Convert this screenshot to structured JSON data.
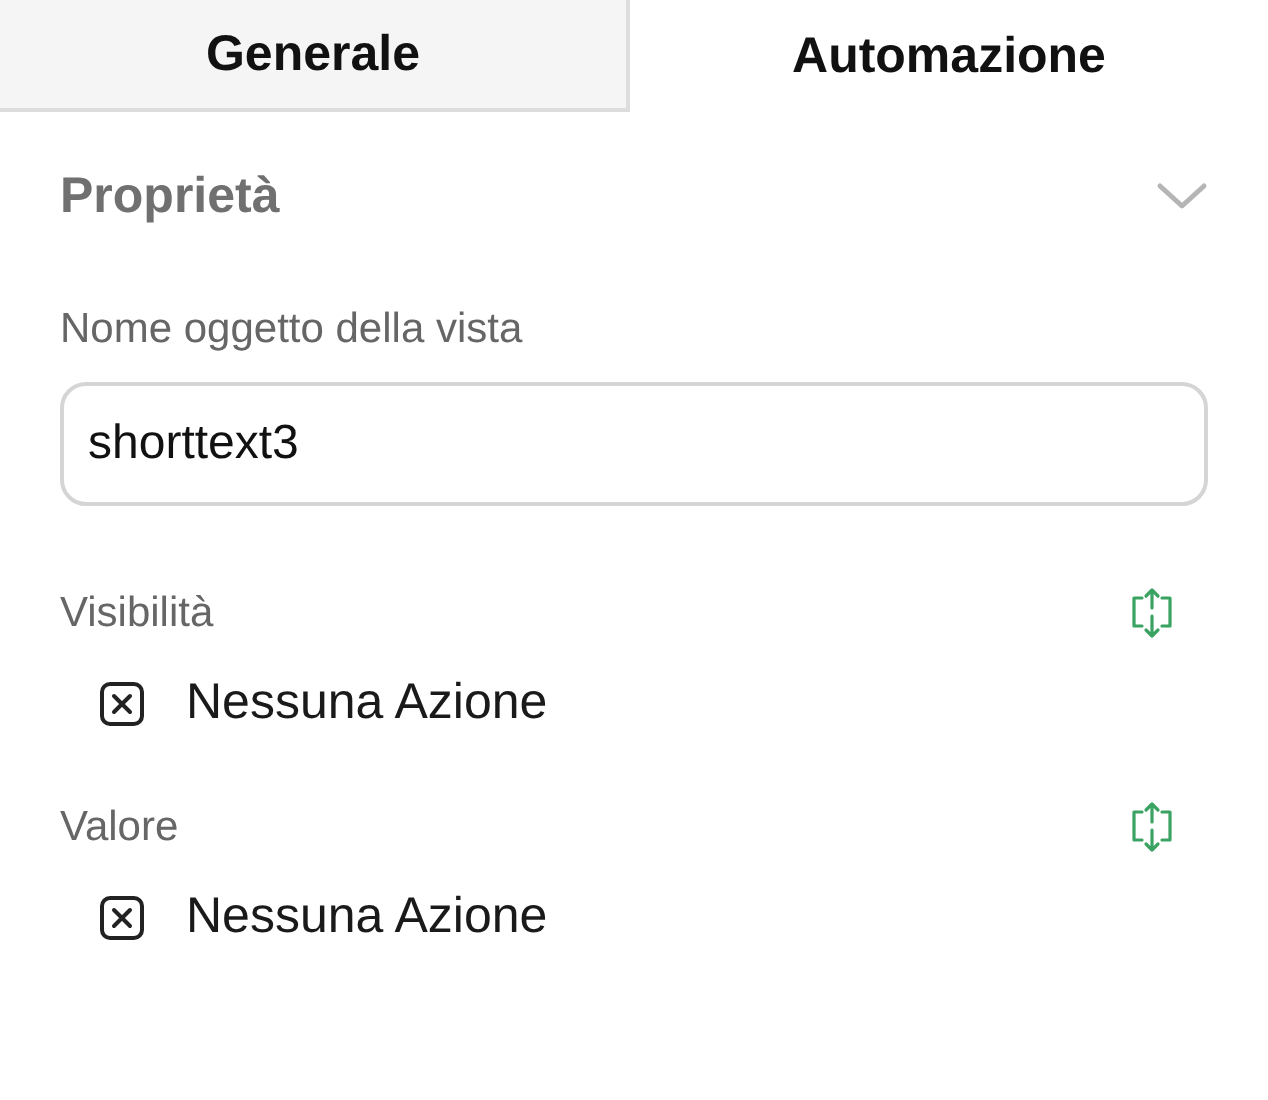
{
  "tabs": [
    {
      "label": "Generale",
      "selected": false
    },
    {
      "label": "Automazione",
      "selected": true
    }
  ],
  "section": {
    "title": "Proprietà",
    "expanded": true,
    "field": {
      "label": "Nome oggetto della vista",
      "value": "shorttext3"
    },
    "rules": [
      {
        "label": "Visibilità",
        "action": "Nessuna Azione"
      },
      {
        "label": "Valore",
        "action": "Nessuna Azione"
      }
    ]
  }
}
